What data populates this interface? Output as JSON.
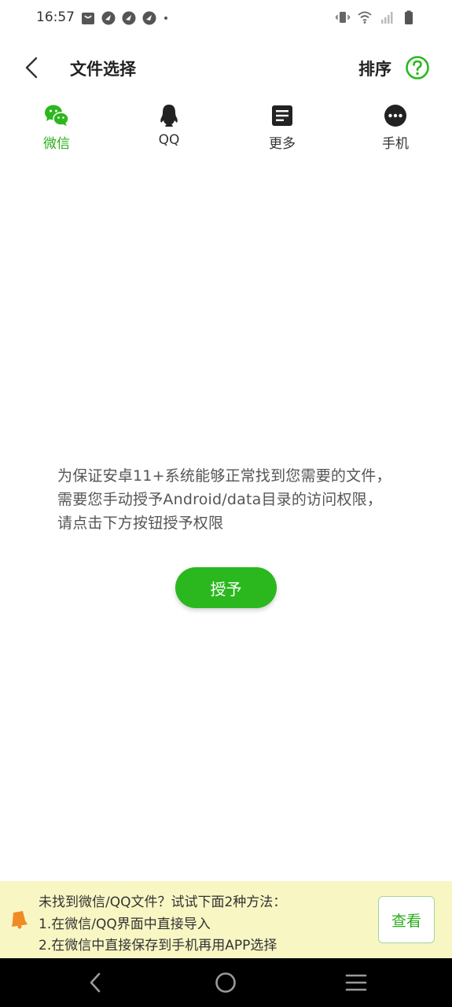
{
  "status_bar": {
    "time": "16:57",
    "left_icons": [
      "shopping-bag-icon",
      "notification-icon",
      "notification-icon",
      "notification-icon",
      "dot-icon"
    ],
    "right_icons": [
      "vibrate-icon",
      "wifi-icon",
      "signal-icon",
      "battery-icon"
    ]
  },
  "header": {
    "title": "文件选择",
    "sort_label": "排序"
  },
  "tabs": [
    {
      "label": "微信",
      "icon": "wechat-icon",
      "active": true
    },
    {
      "label": "QQ",
      "icon": "qq-icon",
      "active": false
    },
    {
      "label": "更多",
      "icon": "document-icon",
      "active": false
    },
    {
      "label": "手机",
      "icon": "more-dots-icon",
      "active": false
    }
  ],
  "main": {
    "message": "为保证安卓11+系统能够正常找到您需要的文件，需要您手动授予Android/data目录的访问权限，请点击下方按钮授予权限",
    "grant_label": "授予"
  },
  "tip": {
    "line1": "未找到微信/QQ文件？试试下面2种方法：",
    "line2": "1.在微信/QQ界面中直接导入",
    "line3": "2.在微信中直接保存到手机再用APP选择",
    "view_label": "查看"
  },
  "colors": {
    "accent": "#2bb81f",
    "tip_background": "#f8f7c4",
    "tip_icon": "#f08a24",
    "nav_background": "#000000"
  }
}
